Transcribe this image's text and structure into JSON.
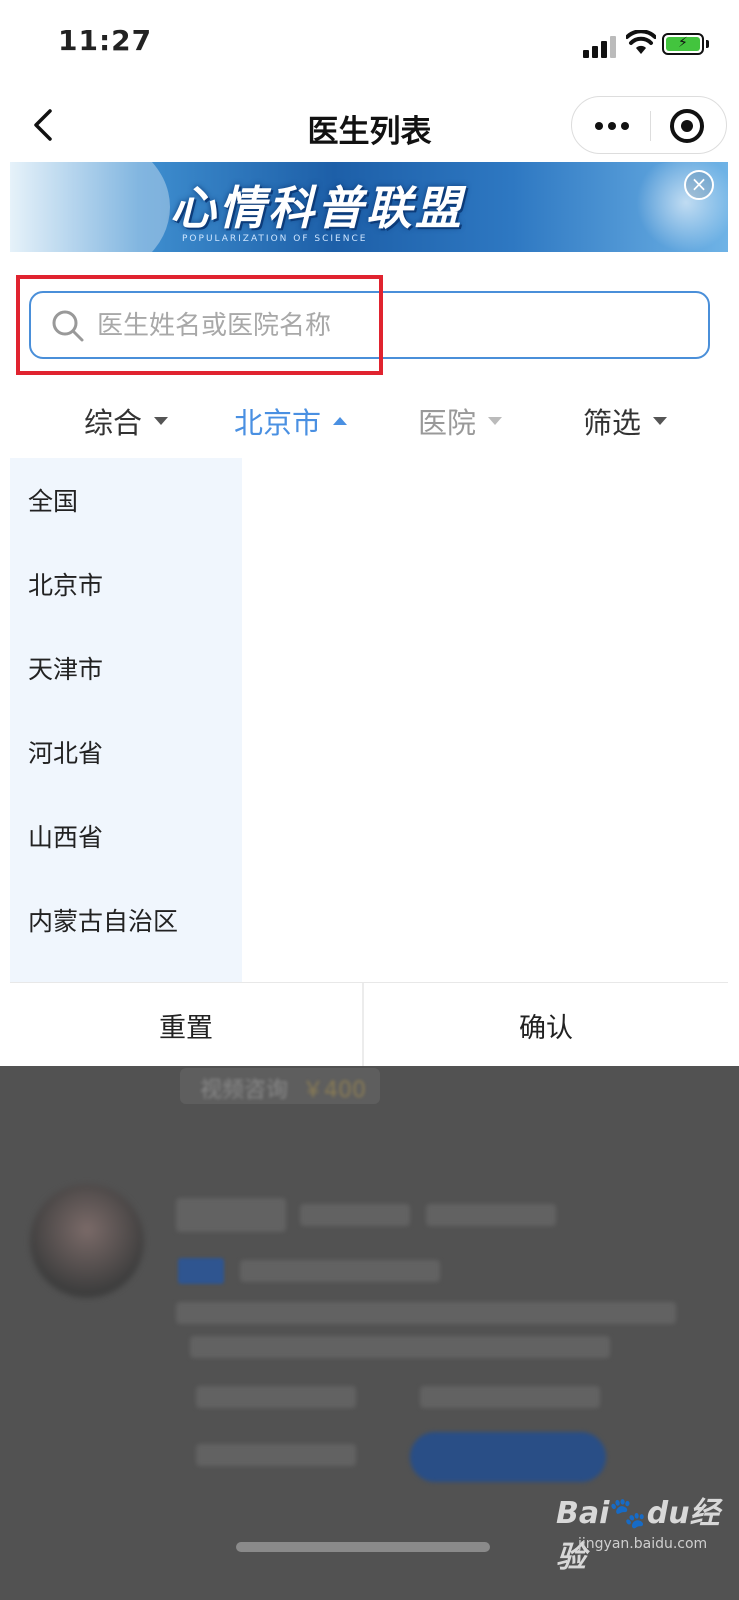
{
  "status_bar": {
    "time": "11:27"
  },
  "nav": {
    "title": "医生列表"
  },
  "banner": {
    "title": "心情科普联盟",
    "subtitle": "POPULARIZATION OF SCIENCE"
  },
  "search": {
    "placeholder": "医生姓名或医院名称",
    "value": ""
  },
  "filters": [
    {
      "label": "综合",
      "state": "collapsed"
    },
    {
      "label": "北京市",
      "state": "expanded"
    },
    {
      "label": "医院",
      "state": "disabled"
    },
    {
      "label": "筛选",
      "state": "collapsed"
    }
  ],
  "regions": [
    "全国",
    "北京市",
    "天津市",
    "河北省",
    "山西省",
    "内蒙古自治区"
  ],
  "actions": {
    "reset": "重置",
    "confirm": "确认"
  },
  "background_card": {
    "service": "视频咨询",
    "price": "￥400"
  },
  "watermark": {
    "brand": "Bai",
    "brand_mid": "du",
    "brand_cn": "经验",
    "url": "jingyan.baidu.com"
  },
  "colors": {
    "accent": "#4a90e2",
    "highlight": "#e0232f",
    "region_bg": "#f0f6fd",
    "overlay": "#525252"
  }
}
